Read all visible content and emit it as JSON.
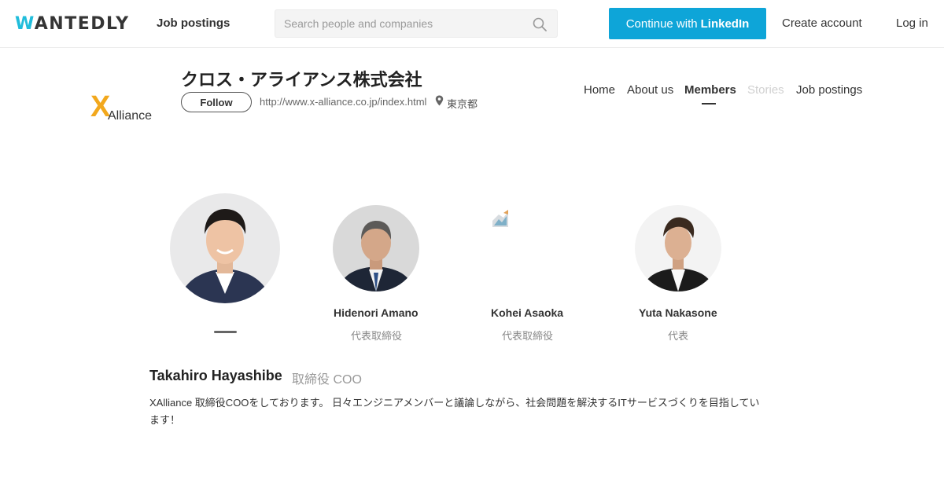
{
  "header": {
    "logo_first": "W",
    "logo_rest": "ANTEDLY",
    "job_postings": "Job postings",
    "search_placeholder": "Search people and companies",
    "linkedin_prefix": "Continue with",
    "linkedin_brand": "LinkedIn",
    "create_account": "Create account",
    "login": "Log in"
  },
  "company": {
    "name": "クロス・アライアンス株式会社",
    "follow_label": "Follow",
    "url": "http://www.x-alliance.co.jp/index.html",
    "location": "東京都",
    "logo_text_x": "X",
    "logo_text_rest": "Alliance"
  },
  "tabs": {
    "home": "Home",
    "about": "About us",
    "members": "Members",
    "stories": "Stories",
    "jobs": "Job postings"
  },
  "members": [
    {
      "name": "Takahiro Hayashibe",
      "role": "取締役 COO",
      "selected": true
    },
    {
      "name": "Hidenori Amano",
      "role": "代表取締役"
    },
    {
      "name": "Kohei Asaoka",
      "role": "代表取締役"
    },
    {
      "name": "Yuta Nakasone",
      "role": "代表"
    }
  ],
  "selected_member": {
    "name": "Takahiro Hayashibe",
    "role": "取締役 COO",
    "description": "XAlliance 取締役COOをしております。 日々エンジニアメンバーと議論しながら、社会問題を解決するITサービスづくりを目指しています！"
  },
  "colors": {
    "brand": "#21bddb",
    "linkedin_button": "#0ea5d8",
    "logo_orange": "#f2a81d"
  }
}
